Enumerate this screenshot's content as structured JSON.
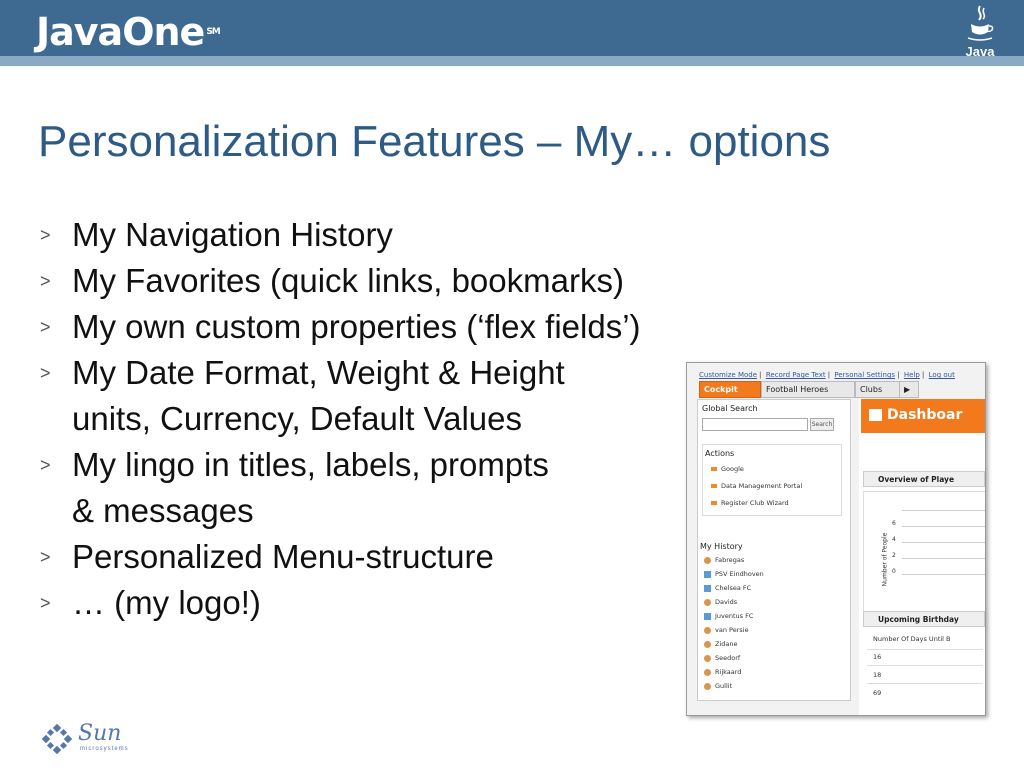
{
  "header": {
    "brand": "JavaOne",
    "brand_mark": "SM",
    "java_logo_text": "Java"
  },
  "slide": {
    "title": "Personalization Features – My… options",
    "bullets": [
      {
        "line1": "My Navigation History",
        "line2": ""
      },
      {
        "line1": "My Favorites (quick links, bookmarks)",
        "line2": ""
      },
      {
        "line1": "My own custom properties (‘flex fields’)",
        "line2": ""
      },
      {
        "line1": "My Date Format, Weight & Height",
        "line2": "units, Currency, Default Values"
      },
      {
        "line1": "My lingo in titles, labels, prompts",
        "line2": "& messages"
      },
      {
        "line1": "Personalized Menu-structure",
        "line2": ""
      },
      {
        "line1": "… (my logo!)",
        "line2": ""
      }
    ],
    "bullet_marker": ">"
  },
  "screenshot": {
    "top_links": [
      "Customize Mode",
      "Record Page Text",
      "Personal Settings",
      "Help",
      "Log out"
    ],
    "tabs": [
      "Cockpit",
      "Football Heroes",
      "Clubs",
      "▶"
    ],
    "global_search_label": "Global Search",
    "search_button": "Search",
    "actions_label": "Actions",
    "actions": [
      "Google",
      "Data Management Portal",
      "Register Club Wizard"
    ],
    "history_label": "My History",
    "history": [
      {
        "label": "Fabregas",
        "kind": "person"
      },
      {
        "label": "PSV Eindhoven",
        "kind": "team"
      },
      {
        "label": "Chelsea FC",
        "kind": "team"
      },
      {
        "label": "Davids",
        "kind": "person"
      },
      {
        "label": "Juventus FC",
        "kind": "team"
      },
      {
        "label": "van Persie",
        "kind": "person"
      },
      {
        "label": "Zidane",
        "kind": "person"
      },
      {
        "label": "Seedorf",
        "kind": "person"
      },
      {
        "label": "Rijkaard",
        "kind": "person"
      },
      {
        "label": "Gullit",
        "kind": "person"
      }
    ],
    "dashboard_title": "Dashboar",
    "overview_title": "Overview of Playe",
    "chart_ylabel": "Number of People",
    "chart_ticks": [
      "6",
      "4",
      "2",
      "0"
    ],
    "birthdays_title": "Upcoming Birthday",
    "birthdays_col_header": "Number Of Days Until B",
    "birthdays_values": [
      "16",
      "18",
      "69"
    ]
  },
  "footer": {
    "sun_word": "Sun",
    "sun_sub": "microsystems"
  },
  "colors": {
    "header_bg": "#3e6a92",
    "title": "#2e5a86",
    "accent_orange": "#f27a1c"
  }
}
